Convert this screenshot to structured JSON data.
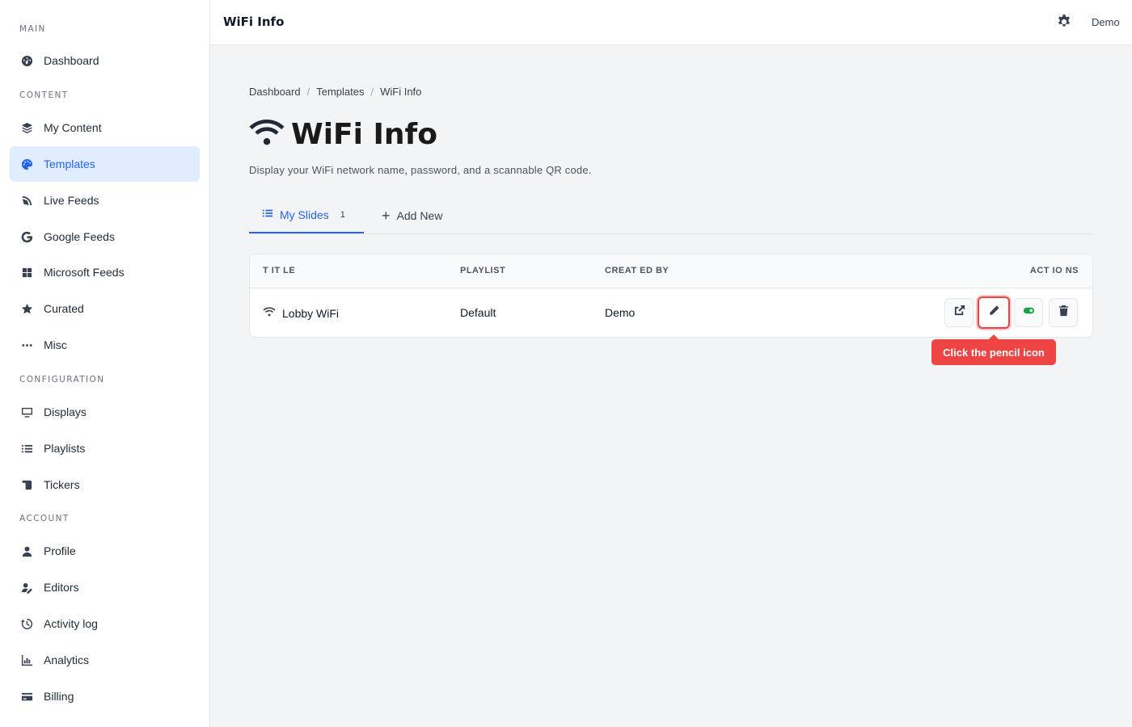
{
  "sidebar": {
    "sections": [
      {
        "label": "MAIN"
      },
      {
        "label": "CONTENT"
      },
      {
        "label": "CONFIGURATION"
      },
      {
        "label": "ACCOUNT"
      }
    ],
    "items": [
      {
        "label": "Dashboard",
        "icon": "dashboard-icon"
      },
      {
        "label": "My Content",
        "icon": "layers-icon"
      },
      {
        "label": "Templates",
        "icon": "palette-icon",
        "active": true
      },
      {
        "label": "Live Feeds",
        "icon": "satellite-icon"
      },
      {
        "label": "Google Feeds",
        "icon": "google-icon"
      },
      {
        "label": "Microsoft Feeds",
        "icon": "windows-icon"
      },
      {
        "label": "Curated",
        "icon": "star-icon"
      },
      {
        "label": "Misc",
        "icon": "ellipsis-icon"
      },
      {
        "label": "Displays",
        "icon": "monitor-icon"
      },
      {
        "label": "Playlists",
        "icon": "list-icon"
      },
      {
        "label": "Tickers",
        "icon": "scroll-icon"
      },
      {
        "label": "Profile",
        "icon": "user-icon"
      },
      {
        "label": "Editors",
        "icon": "user-edit-icon"
      },
      {
        "label": "Activity log",
        "icon": "history-icon"
      },
      {
        "label": "Analytics",
        "icon": "chart-icon"
      },
      {
        "label": "Billing",
        "icon": "credit-card-icon"
      }
    ]
  },
  "header": {
    "title": "WiFi Info",
    "user": "Demo",
    "settings_icon": "gear-icon"
  },
  "breadcrumb": [
    "Dashboard",
    "Templates",
    "WiFi Info"
  ],
  "page": {
    "title": "WiFi Info",
    "icon": "wifi-icon",
    "description": "Display your WiFi network name, password, and a scannable QR code."
  },
  "tabs": {
    "my_slides": {
      "label": "My Slides",
      "count": "1"
    },
    "add_new": {
      "label": "Add New"
    }
  },
  "table": {
    "columns": [
      "T IT LE",
      "PLAYLIST",
      "CREAT ED BY",
      "ACT IO NS"
    ],
    "rows": [
      {
        "title": "Lobby WiFi",
        "playlist": "Default",
        "created_by": "Demo"
      }
    ]
  },
  "tooltip": "Click the pencil icon",
  "colors": {
    "accent": "#2563eb",
    "active_bg": "#e0edff",
    "highlight": "#ef4444",
    "toggle_on": "#16a34a"
  }
}
